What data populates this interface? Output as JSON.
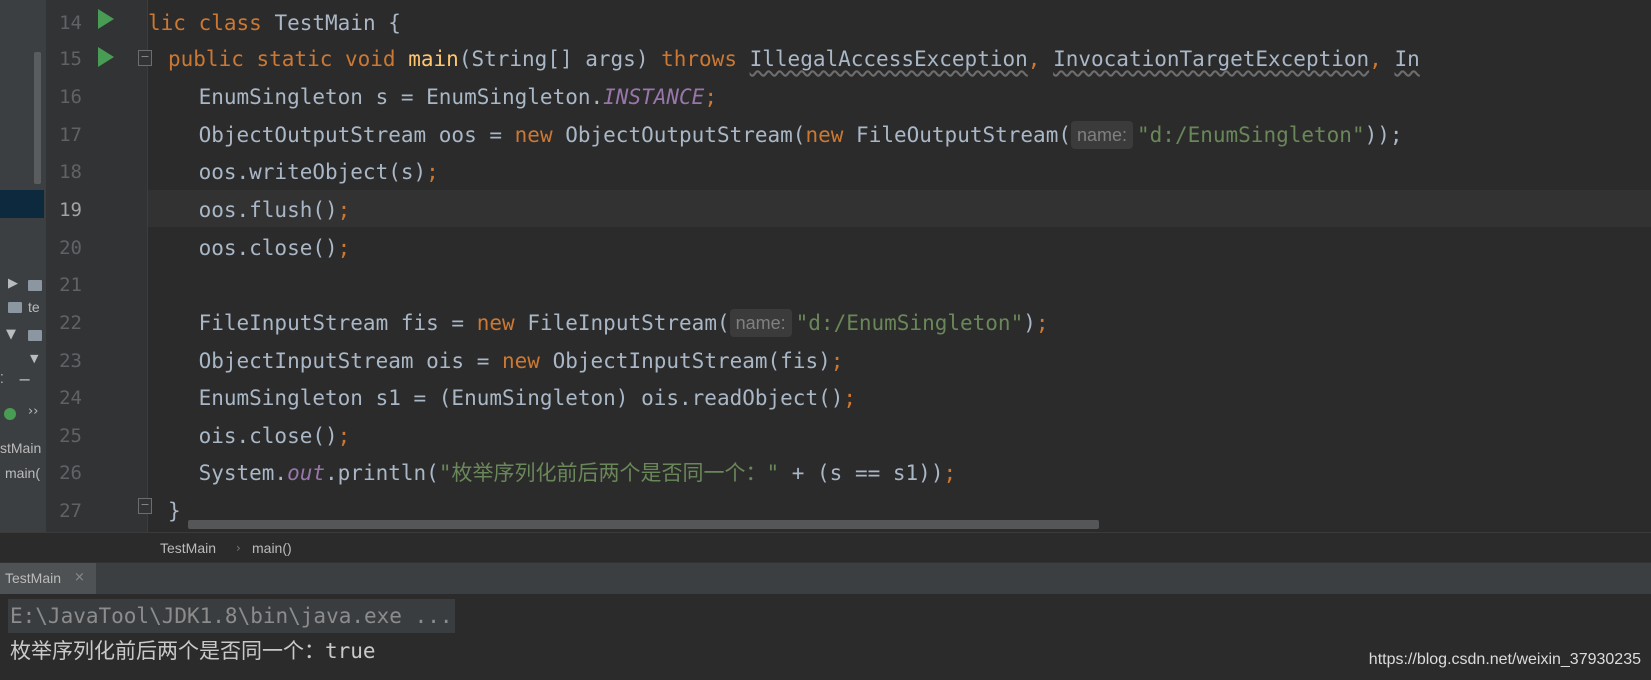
{
  "editor": {
    "line_numbers": [
      "14",
      "15",
      "16",
      "17",
      "18",
      "19",
      "20",
      "21",
      "22",
      "23",
      "24",
      "25",
      "26",
      "27"
    ],
    "current_line": "19",
    "lines": {
      "l14": {
        "kw1": "lic class",
        "t1": " TestMain {"
      },
      "l15": {
        "kw1": "public static void",
        "sp": " ",
        "fn": "main",
        "t1": "(String[] args) ",
        "kw2": "throws",
        "sp2": " ",
        "ex1": "IllegalAccessException",
        "c1": ",",
        "sp3": " ",
        "ex2": "InvocationTargetException",
        "c2": ",",
        "sp4": " ",
        "ex3": "In"
      },
      "l16": {
        "t1": "    EnumSingleton s = EnumSingleton.",
        "it": "INSTANCE",
        "semi": ";"
      },
      "l17": {
        "t1": "    ObjectOutputStream oos = ",
        "kw1": "new",
        "t2": " ObjectOutputStream(",
        "kw2": "new",
        "t3": " FileOutputStream(",
        "hint": "name:",
        "str": "\"d:/EnumSingleton\"",
        "t4": "));"
      },
      "l18": {
        "t1": "    oos.writeObject(s)",
        "semi": ";"
      },
      "l19": {
        "t1": "    oos.flush()",
        "semi": ";"
      },
      "l20": {
        "t1": "    oos.close()",
        "semi": ";"
      },
      "l21": {
        "t1": ""
      },
      "l22": {
        "t1": "    FileInputStream fis = ",
        "kw1": "new",
        "t2": " FileInputStream(",
        "hint": "name:",
        "str": "\"d:/EnumSingleton\"",
        "t3": ")",
        "semi": ";"
      },
      "l23": {
        "t1": "    ObjectInputStream ois = ",
        "kw1": "new",
        "t2": " ObjectInputStream(fis)",
        "semi": ";"
      },
      "l24": {
        "t1": "    EnumSingleton s1 = (EnumSingleton) ois.readObject()",
        "semi": ";"
      },
      "l25": {
        "t1": "    ois.close()",
        "semi": ";"
      },
      "l26": {
        "t1": "    System.",
        "it": "out",
        "t2": ".println(",
        "str": "\"枚举序列化前后两个是否同一个：\"",
        "t3": " + (s == s1))",
        "semi": ";"
      },
      "l27": {
        "t1": "}"
      }
    }
  },
  "project_strip": {
    "tree_label": "te",
    "structure_class": "stMain",
    "structure_method": "main(",
    "collapse_glyph": "−",
    "expand_glyph": "››"
  },
  "breadcrumb": {
    "items": [
      "TestMain",
      "main()"
    ],
    "separator": "›"
  },
  "run_panel": {
    "tab_label": "TestMain",
    "tab_close": "×",
    "command_line": "E:\\JavaTool\\JDK1.8\\bin\\java.exe ...",
    "output_line": "枚举序列化前后两个是否同一个：true"
  },
  "watermark": "https://blog.csdn.net/weixin_37930235",
  "colors": {
    "background": "#2b2b2b",
    "keyword": "#cc7832",
    "method_declaration": "#ffc66d",
    "static_field": "#9876aa",
    "string": "#6a8759",
    "run_gutter_icon": "#499c54"
  }
}
